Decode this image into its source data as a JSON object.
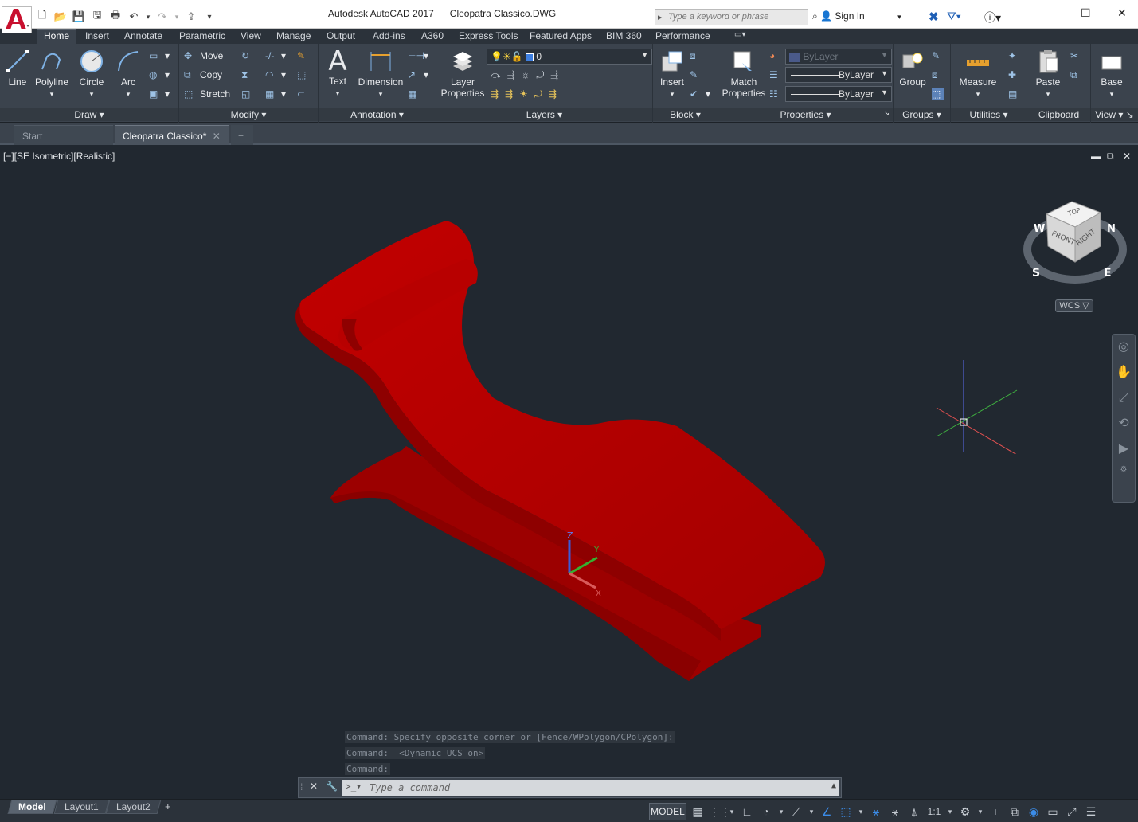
{
  "window": {
    "app_title": "Autodesk AutoCAD 2017",
    "file_title": "Cleopatra Classico.DWG",
    "search_placeholder": "Type a keyword or phrase",
    "sign_in": "Sign In"
  },
  "ribbon_tabs": [
    "Home",
    "Insert",
    "Annotate",
    "Parametric",
    "View",
    "Manage",
    "Output",
    "Add-ins",
    "A360",
    "Express Tools",
    "Featured Apps",
    "BIM 360",
    "Performance"
  ],
  "draw": {
    "line": "Line",
    "polyline": "Polyline",
    "circle": "Circle",
    "arc": "Arc",
    "label": "Draw"
  },
  "modify": {
    "move": "Move",
    "copy": "Copy",
    "stretch": "Stretch",
    "label": "Modify"
  },
  "annotation": {
    "text": "Text",
    "dimension": "Dimension",
    "label": "Annotation"
  },
  "layers": {
    "layer_props_1": "Layer",
    "layer_props_2": "Properties",
    "current_layer": "0",
    "label": "Layers"
  },
  "block": {
    "insert": "Insert",
    "label": "Block"
  },
  "properties": {
    "match_1": "Match",
    "match_2": "Properties",
    "color": "ByLayer",
    "linetype": "ByLayer",
    "lineweight": "ByLayer",
    "label": "Properties"
  },
  "groups": {
    "group": "Group",
    "label": "Groups"
  },
  "utilities": {
    "measure": "Measure",
    "label": "Utilities"
  },
  "clipboard": {
    "paste": "Paste",
    "label": "Clipboard"
  },
  "view": {
    "base": "Base",
    "label": "View"
  },
  "doc_tabs": {
    "start": "Start",
    "active": "Cleopatra Classico*",
    "new": "+"
  },
  "viewport": {
    "label": "[−][SE Isometric][Realistic]",
    "wcs": "WCS",
    "cube_top": "TOP",
    "cube_front": "FRONT",
    "cube_right": "RIGHT",
    "compass_n": "N",
    "compass_s": "S",
    "compass_e": "E",
    "compass_w": "W",
    "ucs_z": "Z",
    "ucs_y": "Y",
    "ucs_x": "X"
  },
  "command": {
    "history": [
      "Command: Specify opposite corner or [Fence/WPolygon/CPolygon]:",
      "Command:  <Dynamic UCS on>",
      "Command:"
    ],
    "placeholder": "Type a command"
  },
  "layout_tabs": [
    "Model",
    "Layout1",
    "Layout2"
  ],
  "status": {
    "model": "MODEL",
    "scale": "1:1"
  },
  "colors": {
    "object": "#b00000",
    "viewport": "#212830",
    "ribbon": "#3b434d"
  }
}
